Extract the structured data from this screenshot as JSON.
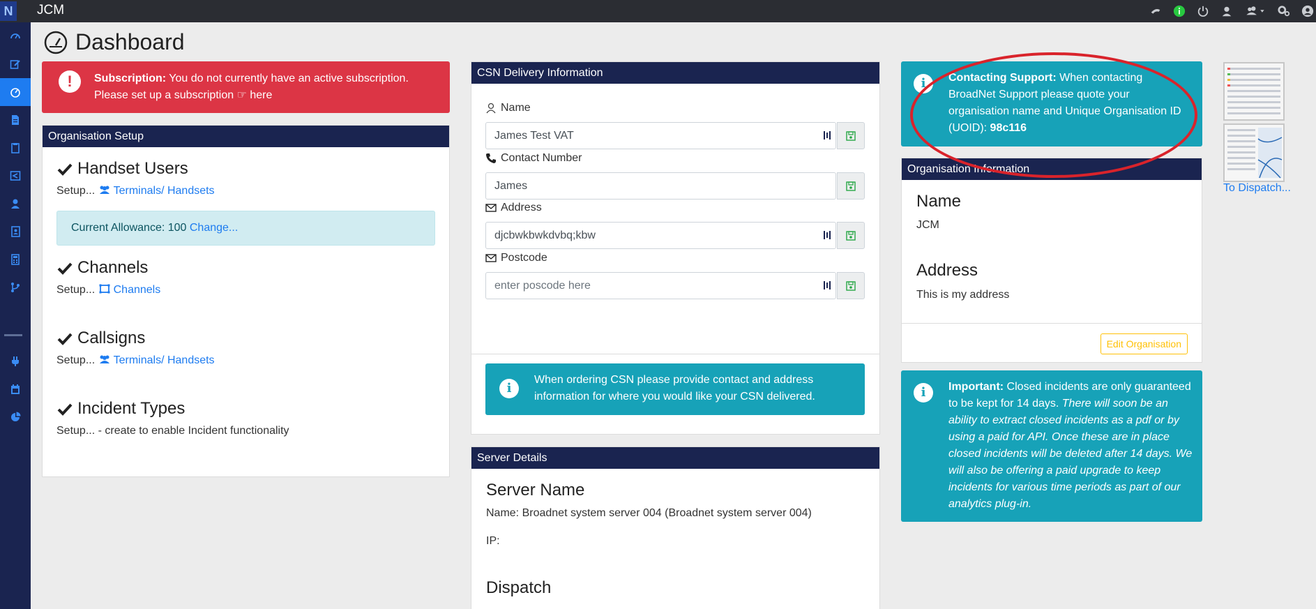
{
  "app": {
    "logo_letter": "N",
    "title": "JCM"
  },
  "colors": {
    "topbar": "#2b2d33",
    "sidebar": "#1a2450",
    "accent": "#1e7cf0",
    "danger": "#dc3545",
    "info": "#17a2b8",
    "card_header": "#1a2450"
  },
  "topbar_icons": [
    "dispatch-icon",
    "info-icon",
    "power-icon",
    "user-secret-icon",
    "users-dropdown-icon",
    "cogs-icon",
    "account-icon"
  ],
  "sidebar_icons": [
    "dashboard-icon",
    "edit-icon",
    "dashboard-active-icon",
    "file-icon",
    "clipboard-icon",
    "share-icon",
    "user-icon",
    "address-book-icon",
    "calculator-icon",
    "branch-icon",
    "plug-icon",
    "calendar-icon",
    "pie-chart-icon"
  ],
  "page": {
    "title": "Dashboard"
  },
  "subscription_alert": {
    "label": "Subscription:",
    "text": " You do not currently have an active subscription. Please set up a subscription ",
    "link": "here"
  },
  "org_setup": {
    "header": "Organisation Setup",
    "handset_users": {
      "title": "Handset Users",
      "setup": "Setup...",
      "link": "Terminals/ Handsets"
    },
    "allowance": {
      "text": "Current Allowance: 100 ",
      "link": "Change..."
    },
    "channels": {
      "title": "Channels",
      "setup": "Setup...",
      "link": "Channels"
    },
    "callsigns": {
      "title": "Callsigns",
      "setup": "Setup...",
      "link": "Terminals/ Handsets"
    },
    "incident_types": {
      "title": "Incident Types",
      "setup": "Setup... - create to enable Incident functionality"
    }
  },
  "csn": {
    "header": "CSN Delivery Information",
    "name": {
      "label": "Name",
      "value": "James Test VAT"
    },
    "contact": {
      "label": "Contact Number",
      "value": "James"
    },
    "address": {
      "label": "Address",
      "value": "djcbwkbwkdvbq;kbw"
    },
    "postcode": {
      "label": "Postcode",
      "placeholder": "enter poscode here"
    },
    "info": "When ordering CSN please provide contact and address information for where you would like your CSN delivered."
  },
  "server": {
    "header": "Server Details",
    "server_name_title": "Server Name",
    "name_line": "Name: Broadnet system server 004 (Broadnet system server 004)",
    "ip_line": "IP:",
    "dispatch_title": "Dispatch"
  },
  "support": {
    "label": "Contacting Support:",
    "text": " When contacting BroadNet Support please quote your organisation name and Unique Organisation ID (UOID): ",
    "uoid": "98c116"
  },
  "org_info": {
    "header": "Organisation Information",
    "name_title": "Name",
    "name_value": "JCM",
    "address_title": "Address",
    "address_value": "This is my address",
    "edit_button": "Edit Organisation"
  },
  "important": {
    "label": "Important:",
    "text": " Closed incidents are only guaranteed to be kept for 14 days.",
    "italic": " There will soon be an ability to extract closed incidents as a pdf or by using a paid for API. Once these are in place closed incidents will be deleted after 14 days. We will also be offering a paid upgrade to keep incidents for various time periods as part of our analytics plug-in."
  },
  "dispatch_link": "To Dispatch..."
}
